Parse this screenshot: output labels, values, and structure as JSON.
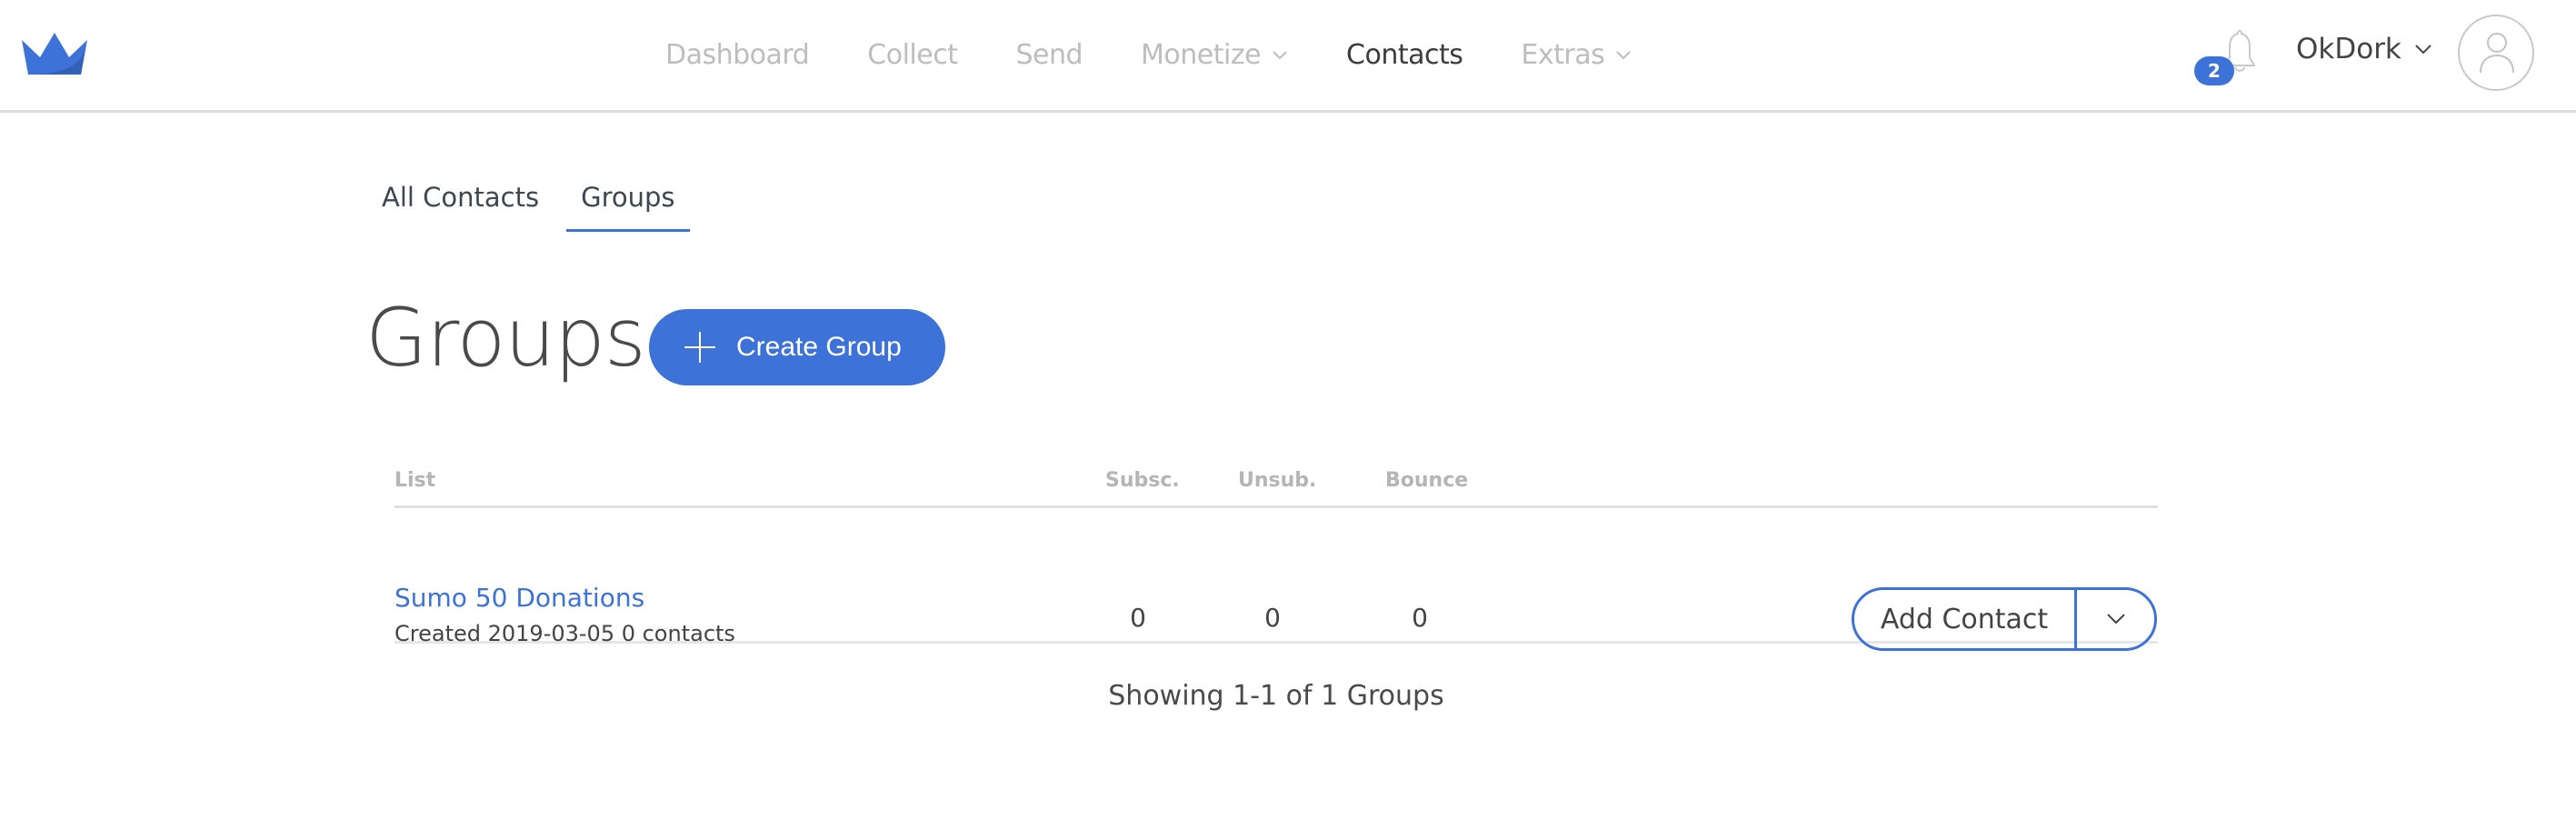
{
  "brand": {
    "logo_icon": "crown-icon",
    "accent": "#3d72d9"
  },
  "nav": {
    "items": [
      {
        "label": "Dashboard",
        "active": false,
        "dropdown": false
      },
      {
        "label": "Collect",
        "active": false,
        "dropdown": false
      },
      {
        "label": "Send",
        "active": false,
        "dropdown": false
      },
      {
        "label": "Monetize",
        "active": false,
        "dropdown": true
      },
      {
        "label": "Contacts",
        "active": true,
        "dropdown": false
      },
      {
        "label": "Extras",
        "active": false,
        "dropdown": true
      }
    ]
  },
  "header": {
    "notifications_count": "2",
    "user_name": "OkDork"
  },
  "subtabs": [
    {
      "label": "All Contacts",
      "active": false
    },
    {
      "label": "Groups",
      "active": true
    }
  ],
  "page": {
    "title": "Groups",
    "create_button": "Create Group"
  },
  "table": {
    "columns": [
      "List",
      "Subsc.",
      "Unsub.",
      "Bounce"
    ],
    "rows": [
      {
        "name": "Sumo 50 Donations",
        "meta": "Created 2019-03-05 0 contacts",
        "subscribed": "0",
        "unsubscribed": "0",
        "bounce": "0",
        "action": "Add Contact"
      }
    ]
  },
  "pagination": {
    "summary": "Showing 1-1 of 1 Groups"
  }
}
